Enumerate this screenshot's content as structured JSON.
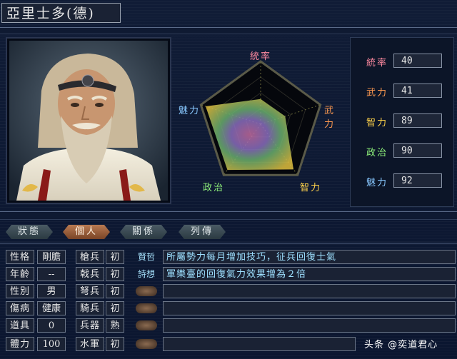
{
  "title": "亞里士多(德)",
  "radar": {
    "labels": [
      "統率",
      "武力",
      "智力",
      "政治",
      "魅力"
    ],
    "values": [
      40,
      41,
      89,
      90,
      92
    ],
    "max": 100
  },
  "stats": [
    {
      "label": "統率",
      "value": "40",
      "color": "#ff8aa0"
    },
    {
      "label": "武力",
      "value": "41",
      "color": "#ff9a50"
    },
    {
      "label": "智力",
      "value": "89",
      "color": "#ffd24a"
    },
    {
      "label": "政治",
      "value": "90",
      "color": "#8ef07a"
    },
    {
      "label": "魅力",
      "value": "92",
      "color": "#88c8ff"
    }
  ],
  "tabs": [
    "狀態",
    "個人",
    "關係",
    "列傳"
  ],
  "active_tab": "個人",
  "attributes": [
    {
      "label": "性格",
      "value": "剛膽"
    },
    {
      "label": "年齡",
      "value": "--"
    },
    {
      "label": "性別",
      "value": "男"
    },
    {
      "label": "傷病",
      "value": "健康"
    },
    {
      "label": "道具",
      "value": "0"
    },
    {
      "label": "體力",
      "value": "100"
    }
  ],
  "troops": [
    {
      "label": "槍兵",
      "value": "初"
    },
    {
      "label": "戟兵",
      "value": "初"
    },
    {
      "label": "弩兵",
      "value": "初"
    },
    {
      "label": "騎兵",
      "value": "初"
    },
    {
      "label": "兵器",
      "value": "熟"
    },
    {
      "label": "水軍",
      "value": "初"
    }
  ],
  "skills": [
    {
      "name": "賢哲",
      "desc": "所屬勢力每月增加技巧，征兵回復士氣"
    },
    {
      "name": "詩想",
      "desc": "軍樂臺的回復氣力效果增為２倍"
    },
    {
      "name": "",
      "desc": ""
    },
    {
      "name": "",
      "desc": ""
    },
    {
      "name": "",
      "desc": ""
    },
    {
      "name": "",
      "desc": ""
    }
  ],
  "watermark": "头条 @奕道君心"
}
